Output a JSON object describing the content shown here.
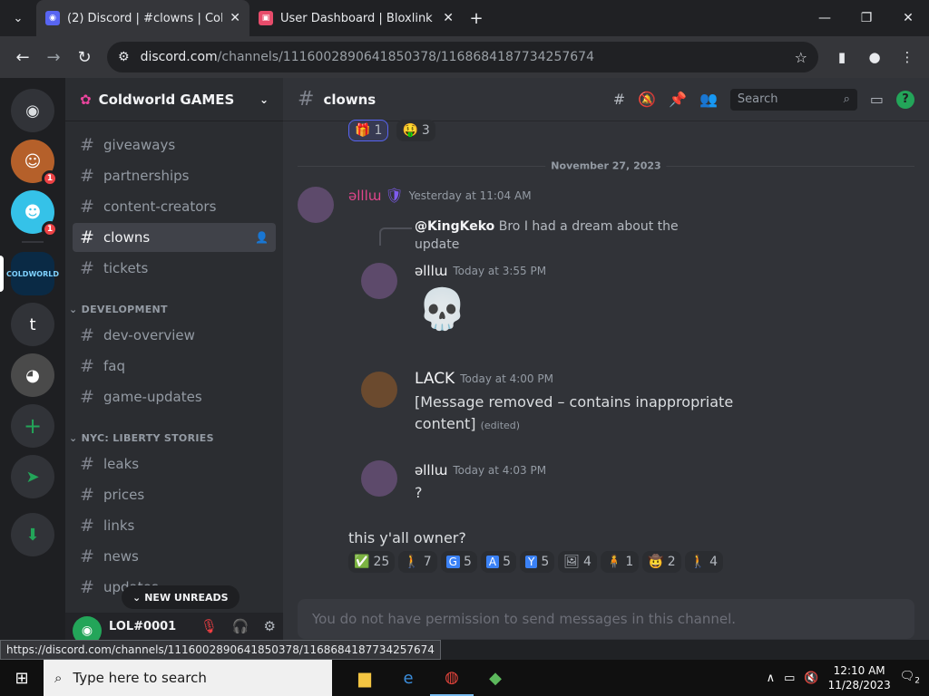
{
  "browser": {
    "tabs": [
      {
        "title": "(2) Discord | #clowns | Coldworld",
        "favicon": "discord-icon",
        "active": true
      },
      {
        "title": "User Dashboard | Bloxlink",
        "favicon": "bloxlink-icon",
        "active": false
      }
    ],
    "url_domain": "discord.com",
    "url_path": "/channels/1116002890641850378/1168684187734257674",
    "status_url": "https://discord.com/channels/1116002890641850378/1168684187734257674"
  },
  "servers": [
    {
      "name": "discord-home",
      "badge": ""
    },
    {
      "name": "server-1",
      "badge": "1"
    },
    {
      "name": "server-2",
      "badge": "1"
    },
    {
      "name": "COLDWORLD",
      "badge": ""
    },
    {
      "name": "t",
      "badge": ""
    },
    {
      "name": "server-5",
      "badge": ""
    }
  ],
  "guild": {
    "name": "Coldworld GAMES"
  },
  "channels": {
    "top": [
      "giveaways",
      "partnerships",
      "content-creators",
      "clowns",
      "tickets"
    ],
    "selected": "clowns",
    "categories": [
      {
        "name": "DEVELOPMENT",
        "items": [
          "dev-overview",
          "faq",
          "game-updates"
        ]
      },
      {
        "name": "NYC: LIBERTY STORIES",
        "items": [
          "leaks",
          "prices",
          "links",
          "news",
          "updates"
        ]
      }
    ],
    "new_unreads": "NEW UNREADS"
  },
  "user": {
    "name": "LOL#0001"
  },
  "header": {
    "channel": "clowns",
    "search_placeholder": "Search",
    "help": "?"
  },
  "top_reactions": [
    {
      "emoji": "🎁",
      "count": "1"
    },
    {
      "emoji": "🤑",
      "count": "3"
    }
  ],
  "date_divider": "November 27, 2023",
  "messages": [
    {
      "author": "ǝlllɯ",
      "time": "Yesterday at 11:04 AM"
    },
    {
      "reply_author": "@KingKeko",
      "reply_text": "Bro I had a dream about the update"
    },
    {
      "author": "ǝlllɯ",
      "time": "Today at 3:55 PM",
      "text": "💀"
    },
    {
      "author": "LACK",
      "time": "Today at 4:00 PM",
      "text": "[Message removed – contains inappropriate content]",
      "edited": "(edited)"
    },
    {
      "author": "ǝlllɯ",
      "time": "Today at 4:03 PM",
      "text": "?"
    },
    {
      "text": "this y'all owner?"
    }
  ],
  "bottom_reactions": [
    {
      "emoji": "✅",
      "count": "25"
    },
    {
      "emoji": "🚶",
      "count": "7"
    },
    {
      "emoji": "G",
      "count": "5"
    },
    {
      "emoji": "A",
      "count": "5"
    },
    {
      "emoji": "Y",
      "count": "5"
    },
    {
      "emoji": "🖼",
      "count": "4"
    },
    {
      "emoji": "🧍",
      "count": "1"
    },
    {
      "emoji": "🤠",
      "count": "2"
    },
    {
      "emoji": "🚶",
      "count": "4"
    }
  ],
  "composer_text": "You do not have permission to send messages in this channel.",
  "taskbar": {
    "search_placeholder": "Type here to search",
    "time": "12:10 AM",
    "date": "11/28/2023",
    "notifications": "2"
  }
}
